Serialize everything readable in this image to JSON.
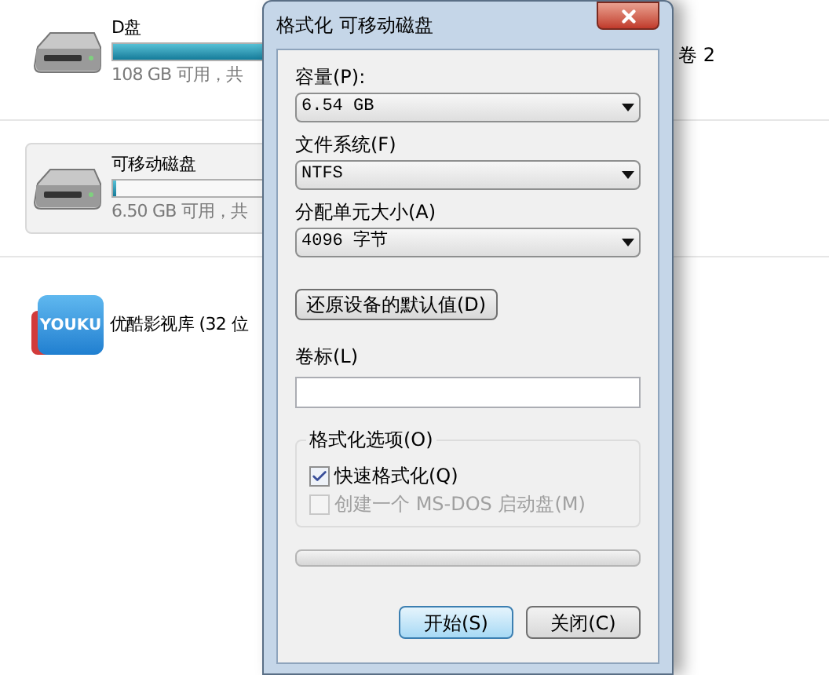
{
  "drives": [
    {
      "kind": "drive",
      "name": "D盘",
      "level": 0.85,
      "free": "108 GB 可用，共",
      "selected": false
    },
    {
      "kind": "drive",
      "name": "可移动磁盘",
      "level": 0.01,
      "free": "6.50 GB 可用，共",
      "selected": true
    },
    {
      "kind": "library",
      "name": "优酷影视库 (32 位",
      "logo_text": "YOUKU",
      "selected": false
    }
  ],
  "side_text": "卷 2",
  "dialog": {
    "title": "格式化 可移动磁盘",
    "selects": [
      {
        "label": "容量(P):",
        "value": "6.54 GB"
      },
      {
        "label": "文件系统(F)",
        "value": "NTFS"
      },
      {
        "label": "分配单元大小(A)",
        "value": "4096 字节"
      }
    ],
    "restore_button": "还原设备的默认值(D)",
    "volume_label": {
      "label": "卷标(L)"
    },
    "options": {
      "title": "格式化选项(O)",
      "checkboxes": [
        {
          "label": "快速格式化(Q)",
          "checked": true,
          "disabled": false
        },
        {
          "label": "创建一个 MS-DOS 启动盘(M)",
          "checked": false,
          "disabled": true
        }
      ]
    },
    "progress": {
      "level": 0
    },
    "buttons": [
      {
        "label": "开始(S)",
        "default": true
      },
      {
        "label": "关闭(C)",
        "default": false
      }
    ]
  }
}
